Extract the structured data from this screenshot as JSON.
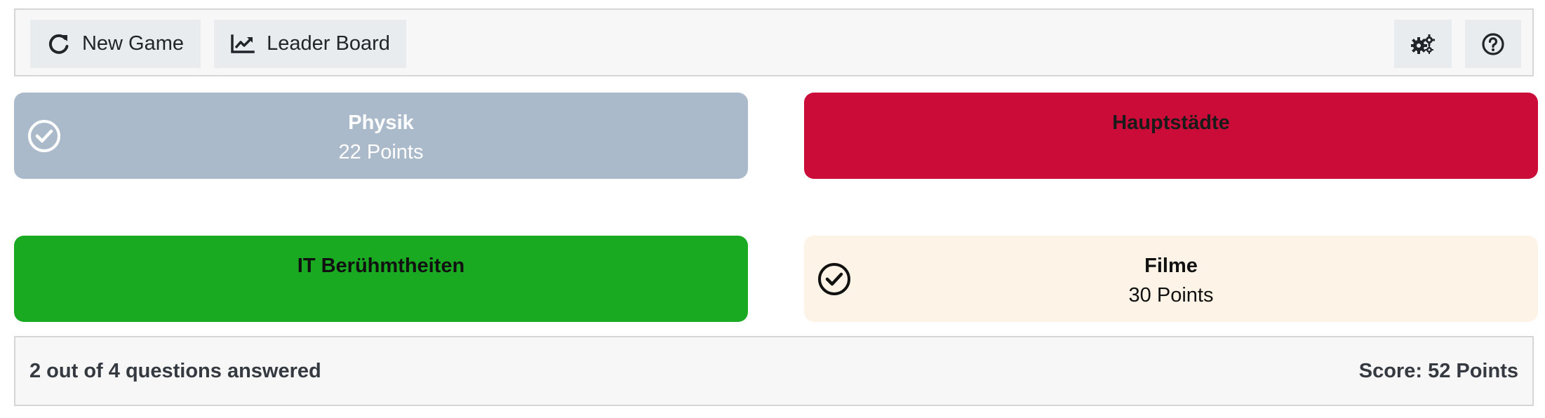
{
  "toolbar": {
    "new_game_label": "New Game",
    "new_game_icon": "redo-icon",
    "leader_board_label": "Leader Board",
    "leader_board_icon": "chart-line-icon",
    "settings_icon": "gears-icon",
    "help_icon": "question-circle-icon"
  },
  "categories": [
    {
      "title": "Physik",
      "points": "22 Points",
      "answered": true,
      "bg": "#abbaca",
      "color": "#ffffff",
      "icon": "check-circle-icon"
    },
    {
      "title": "Hauptstädte",
      "points": "",
      "answered": false,
      "bg": "#cb0c38",
      "color": "#1a1a1a"
    },
    {
      "title": "IT Berühmtheiten",
      "points": "",
      "answered": false,
      "bg": "#1aaa21",
      "color": "#111111"
    },
    {
      "title": "Filme",
      "points": "30 Points",
      "answered": true,
      "bg": "#fdf3e6",
      "color": "#111111",
      "icon": "check-circle-icon"
    }
  ],
  "footer": {
    "progress_text": "2 out of 4 questions answered",
    "score_text": "Score: 52 Points"
  }
}
